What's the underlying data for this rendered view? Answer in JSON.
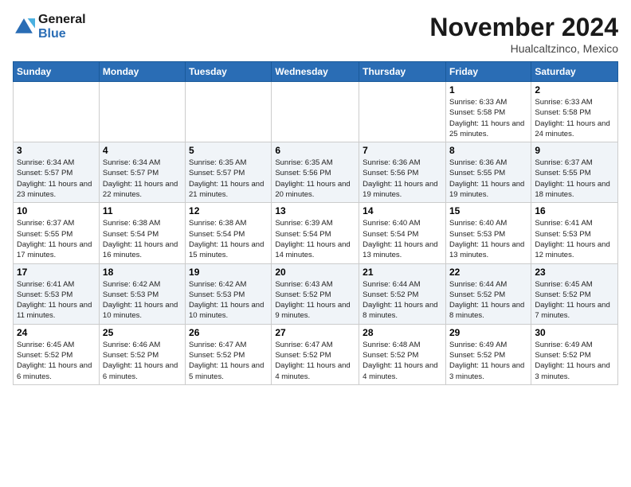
{
  "logo": {
    "line1": "General",
    "line2": "Blue"
  },
  "title": "November 2024",
  "location": "Hualcaltzinco, Mexico",
  "days_of_week": [
    "Sunday",
    "Monday",
    "Tuesday",
    "Wednesday",
    "Thursday",
    "Friday",
    "Saturday"
  ],
  "weeks": [
    [
      {
        "day": "",
        "info": ""
      },
      {
        "day": "",
        "info": ""
      },
      {
        "day": "",
        "info": ""
      },
      {
        "day": "",
        "info": ""
      },
      {
        "day": "",
        "info": ""
      },
      {
        "day": "1",
        "info": "Sunrise: 6:33 AM\nSunset: 5:58 PM\nDaylight: 11 hours and 25 minutes."
      },
      {
        "day": "2",
        "info": "Sunrise: 6:33 AM\nSunset: 5:58 PM\nDaylight: 11 hours and 24 minutes."
      }
    ],
    [
      {
        "day": "3",
        "info": "Sunrise: 6:34 AM\nSunset: 5:57 PM\nDaylight: 11 hours and 23 minutes."
      },
      {
        "day": "4",
        "info": "Sunrise: 6:34 AM\nSunset: 5:57 PM\nDaylight: 11 hours and 22 minutes."
      },
      {
        "day": "5",
        "info": "Sunrise: 6:35 AM\nSunset: 5:57 PM\nDaylight: 11 hours and 21 minutes."
      },
      {
        "day": "6",
        "info": "Sunrise: 6:35 AM\nSunset: 5:56 PM\nDaylight: 11 hours and 20 minutes."
      },
      {
        "day": "7",
        "info": "Sunrise: 6:36 AM\nSunset: 5:56 PM\nDaylight: 11 hours and 19 minutes."
      },
      {
        "day": "8",
        "info": "Sunrise: 6:36 AM\nSunset: 5:55 PM\nDaylight: 11 hours and 19 minutes."
      },
      {
        "day": "9",
        "info": "Sunrise: 6:37 AM\nSunset: 5:55 PM\nDaylight: 11 hours and 18 minutes."
      }
    ],
    [
      {
        "day": "10",
        "info": "Sunrise: 6:37 AM\nSunset: 5:55 PM\nDaylight: 11 hours and 17 minutes."
      },
      {
        "day": "11",
        "info": "Sunrise: 6:38 AM\nSunset: 5:54 PM\nDaylight: 11 hours and 16 minutes."
      },
      {
        "day": "12",
        "info": "Sunrise: 6:38 AM\nSunset: 5:54 PM\nDaylight: 11 hours and 15 minutes."
      },
      {
        "day": "13",
        "info": "Sunrise: 6:39 AM\nSunset: 5:54 PM\nDaylight: 11 hours and 14 minutes."
      },
      {
        "day": "14",
        "info": "Sunrise: 6:40 AM\nSunset: 5:54 PM\nDaylight: 11 hours and 13 minutes."
      },
      {
        "day": "15",
        "info": "Sunrise: 6:40 AM\nSunset: 5:53 PM\nDaylight: 11 hours and 13 minutes."
      },
      {
        "day": "16",
        "info": "Sunrise: 6:41 AM\nSunset: 5:53 PM\nDaylight: 11 hours and 12 minutes."
      }
    ],
    [
      {
        "day": "17",
        "info": "Sunrise: 6:41 AM\nSunset: 5:53 PM\nDaylight: 11 hours and 11 minutes."
      },
      {
        "day": "18",
        "info": "Sunrise: 6:42 AM\nSunset: 5:53 PM\nDaylight: 11 hours and 10 minutes."
      },
      {
        "day": "19",
        "info": "Sunrise: 6:42 AM\nSunset: 5:53 PM\nDaylight: 11 hours and 10 minutes."
      },
      {
        "day": "20",
        "info": "Sunrise: 6:43 AM\nSunset: 5:52 PM\nDaylight: 11 hours and 9 minutes."
      },
      {
        "day": "21",
        "info": "Sunrise: 6:44 AM\nSunset: 5:52 PM\nDaylight: 11 hours and 8 minutes."
      },
      {
        "day": "22",
        "info": "Sunrise: 6:44 AM\nSunset: 5:52 PM\nDaylight: 11 hours and 8 minutes."
      },
      {
        "day": "23",
        "info": "Sunrise: 6:45 AM\nSunset: 5:52 PM\nDaylight: 11 hours and 7 minutes."
      }
    ],
    [
      {
        "day": "24",
        "info": "Sunrise: 6:45 AM\nSunset: 5:52 PM\nDaylight: 11 hours and 6 minutes."
      },
      {
        "day": "25",
        "info": "Sunrise: 6:46 AM\nSunset: 5:52 PM\nDaylight: 11 hours and 6 minutes."
      },
      {
        "day": "26",
        "info": "Sunrise: 6:47 AM\nSunset: 5:52 PM\nDaylight: 11 hours and 5 minutes."
      },
      {
        "day": "27",
        "info": "Sunrise: 6:47 AM\nSunset: 5:52 PM\nDaylight: 11 hours and 4 minutes."
      },
      {
        "day": "28",
        "info": "Sunrise: 6:48 AM\nSunset: 5:52 PM\nDaylight: 11 hours and 4 minutes."
      },
      {
        "day": "29",
        "info": "Sunrise: 6:49 AM\nSunset: 5:52 PM\nDaylight: 11 hours and 3 minutes."
      },
      {
        "day": "30",
        "info": "Sunrise: 6:49 AM\nSunset: 5:52 PM\nDaylight: 11 hours and 3 minutes."
      }
    ]
  ]
}
